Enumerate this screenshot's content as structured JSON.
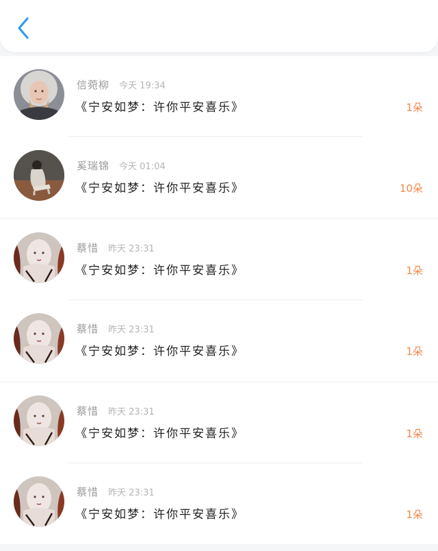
{
  "header": {
    "back_icon": "chevron-left-icon",
    "accent_color": "#2f9bee"
  },
  "gifts": [
    {
      "name": "信菀柳",
      "time": "今天 19:34",
      "title": "《宁安如梦：许你平安喜乐》",
      "count": "1朵"
    },
    {
      "name": "奚瑞锦",
      "time": "今天 01:04",
      "title": "《宁安如梦：许你平安喜乐》",
      "count": "10朵"
    },
    {
      "name": "蔡惜",
      "time": "昨天 23:31",
      "title": "《宁安如梦：许你平安喜乐》",
      "count": "1朵"
    },
    {
      "name": "蔡惜",
      "time": "昨天 23:31",
      "title": "《宁安如梦：许你平安喜乐》",
      "count": "1朵"
    },
    {
      "name": "蔡惜",
      "time": "昨天 23:31",
      "title": "《宁安如梦：许你平安喜乐》",
      "count": "1朵"
    },
    {
      "name": "蔡惜",
      "time": "昨天 23:31",
      "title": "《宁安如梦：许你平安喜乐》",
      "count": "1朵"
    }
  ],
  "colors": {
    "count": "#f0884a",
    "name": "#9a9a9a",
    "title": "#222222"
  }
}
